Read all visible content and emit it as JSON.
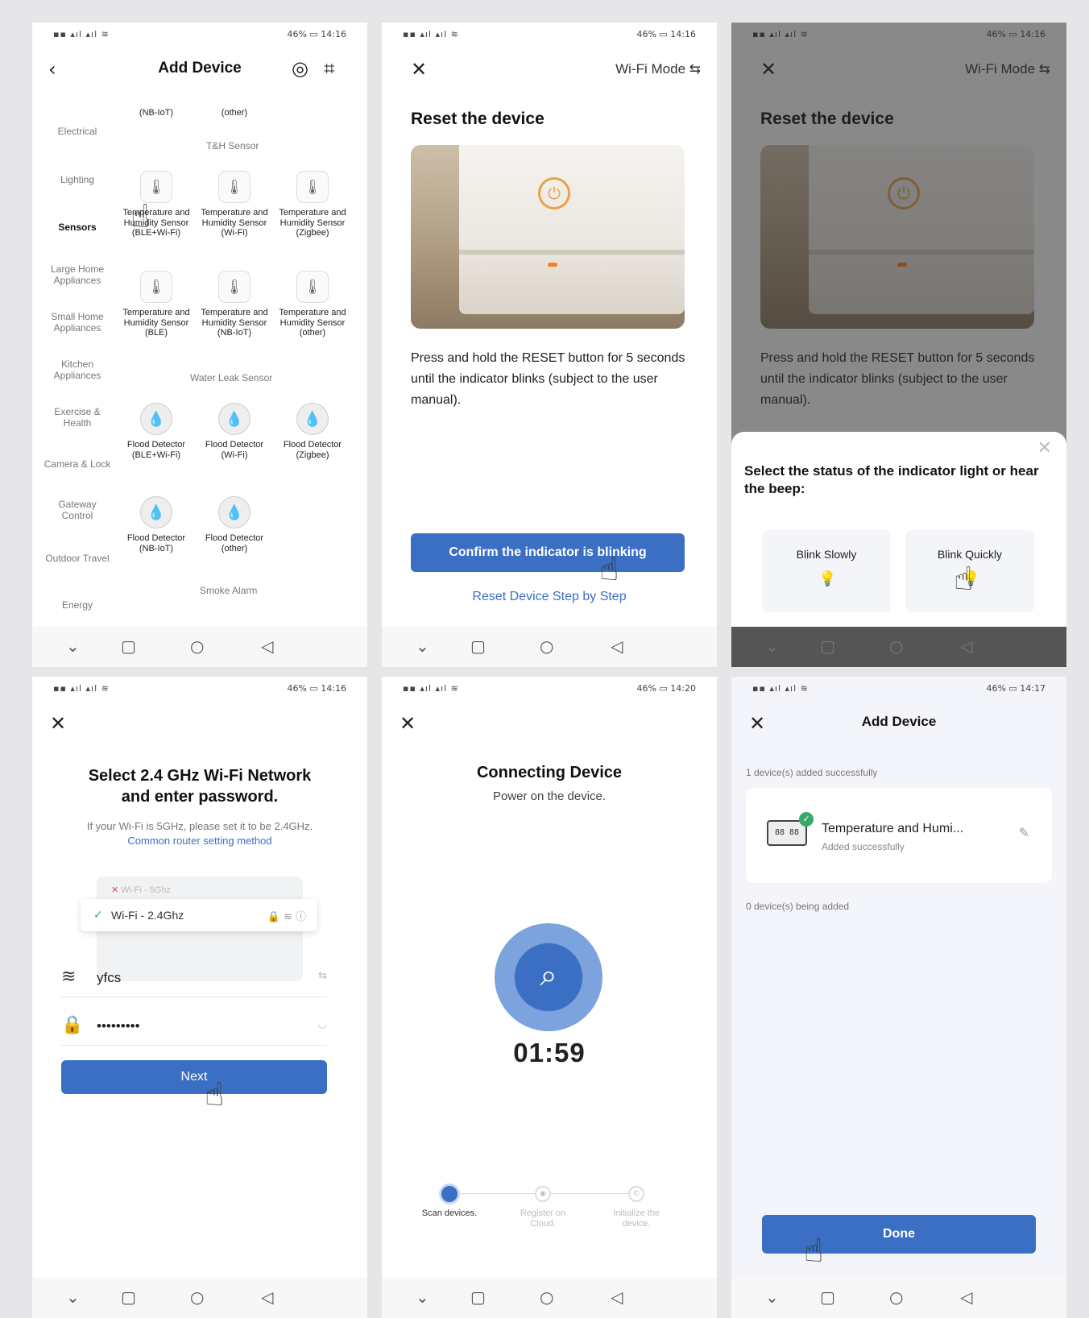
{
  "status": {
    "signal": "▪▪ ▴ıl ▴ıl ≋",
    "battery": "46% ▭ 14:16",
    "battery_p5": "46% ▭ 14:20",
    "battery_p6": "46% ▭ 14:17"
  },
  "p1": {
    "title": "Add Device",
    "categories": [
      "Electrical",
      "Lighting",
      "Sensors",
      "Large Home Appliances",
      "Small Home Appliances",
      "Kitchen Appliances",
      "Exercise & Health",
      "Camera & Lock",
      "Gateway Control",
      "Outdoor Travel",
      "Energy"
    ],
    "top_row": [
      "(NB-IoT)",
      "(other)"
    ],
    "section_th": "T&H Sensor",
    "section_leak": "Water Leak Sensor",
    "section_smoke": "Smoke Alarm",
    "th_devices": [
      "Temperature and Humidity Sensor (BLE+Wi-Fi)",
      "Temperature and Humidity Sensor (Wi-Fi)",
      "Temperature and Humidity Sensor (Zigbee)",
      "Temperature and Humidity Sensor (BLE)",
      "Temperature and Humidity Sensor (NB-IoT)",
      "Temperature and Humidity Sensor (other)"
    ],
    "leak_devices": [
      "Flood Detector (BLE+Wi-Fi)",
      "Flood Detector (Wi-Fi)",
      "Flood Detector (Zigbee)",
      "Flood Detector (NB-IoT)",
      "Flood Detector (other)"
    ]
  },
  "p2": {
    "mode": "Wi-Fi Mode ⇆",
    "title": "Reset the device",
    "desc": "Press and hold the RESET button for 5 seconds until the indicator blinks (subject to the user manual).",
    "confirm": "Confirm the indicator is blinking",
    "link": "Reset Device Step by Step"
  },
  "p3": {
    "question": "Select the status of the indicator light or hear the beep:",
    "slow": "Blink Slowly",
    "quick": "Blink Quickly"
  },
  "p4": {
    "title": "Select 2.4 GHz Wi-Fi Network and enter password.",
    "hint": "If your Wi-Fi is 5GHz, please set it to be 2.4GHz.",
    "link": "Common router setting method",
    "wifi_5g": "Wi-Fi - 5Ghz",
    "wifi_24g": "Wi-Fi - 2.4Ghz",
    "ssid": "yfcs",
    "password": "•••••••••",
    "next": "Next"
  },
  "p5": {
    "title": "Connecting Device",
    "sub": "Power on the device.",
    "timer": "01:59",
    "steps": [
      "Scan devices.",
      "Register on Cloud.",
      "Initialize the device."
    ]
  },
  "p6": {
    "title": "Add Device",
    "added": "1 device(s) added successfully",
    "device_name": "Temperature and Humi...",
    "device_status": "Added successfully",
    "adding": "0 device(s) being added",
    "done": "Done"
  }
}
